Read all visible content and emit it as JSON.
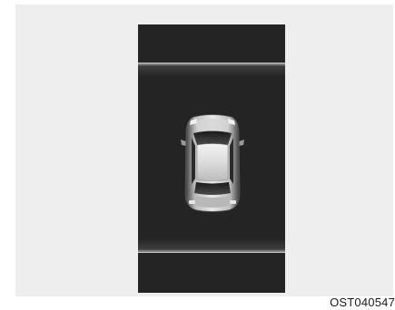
{
  "figure": {
    "caption": "OST040547"
  },
  "screen": {
    "background": "#242424",
    "guide_color": "#ffffff",
    "vehicle": "car-top-view-icon"
  }
}
